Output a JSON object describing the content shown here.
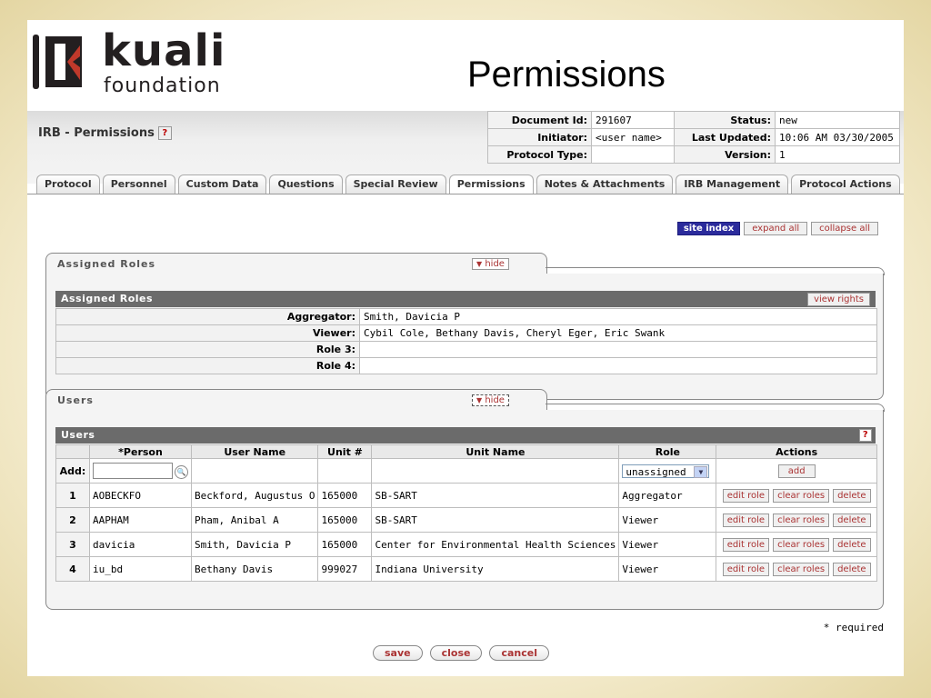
{
  "slide": {
    "title": "Permissions"
  },
  "logo": {
    "word1": "kuali",
    "word2": "foundation"
  },
  "header": {
    "doc_title": "IRB - Permissions",
    "help": "?",
    "info": [
      {
        "label": "Document Id:",
        "value": "291607",
        "label2": "Status:",
        "value2": "new"
      },
      {
        "label": "Initiator:",
        "value": "<user name>",
        "label2": "Last Updated:",
        "value2": "10:06 AM 03/30/2005"
      },
      {
        "label": "Protocol Type:",
        "value": "",
        "label2": "Version:",
        "value2": "1"
      }
    ]
  },
  "tabs": [
    "Protocol",
    "Personnel",
    "Custom Data",
    "Questions",
    "Special Review",
    "Permissions",
    "Notes & Attachments",
    "IRB Management",
    "Protocol Actions"
  ],
  "top_buttons": {
    "site_index": "site index",
    "expand_all": "expand all",
    "collapse_all": "collapse all"
  },
  "assigned_roles": {
    "panel_title": "Assigned Roles",
    "hide": "hide",
    "section_title": "Assigned Roles",
    "view_rights": "view rights",
    "rows": [
      {
        "label": "Aggregator:",
        "value": "Smith, Davicia P"
      },
      {
        "label": "Viewer:",
        "value": "Cybil Cole, Bethany Davis, Cheryl Eger, Eric Swank"
      },
      {
        "label": "Role 3:",
        "value": ""
      },
      {
        "label": "Role 4:",
        "value": ""
      }
    ]
  },
  "users": {
    "panel_title": "Users",
    "hide": "hide",
    "section_title": "Users",
    "help": "?",
    "columns": [
      "*Person",
      "User Name",
      "Unit #",
      "Unit Name",
      "Role",
      "Actions"
    ],
    "add_label": "Add:",
    "add_role_selected": "unassigned",
    "add_button": "add",
    "rows": [
      {
        "num": "1",
        "person": "AOBECKFO",
        "user_name": "Beckford, Augustus O",
        "unit": "165000",
        "unit_name": "SB-SART",
        "role": "Aggregator"
      },
      {
        "num": "2",
        "person": "AAPHAM",
        "user_name": "Pham, Anibal A",
        "unit": "165000",
        "unit_name": "SB-SART",
        "role": "Viewer"
      },
      {
        "num": "3",
        "person": "davicia",
        "user_name": "Smith, Davicia P",
        "unit": "165000",
        "unit_name": "Center for Environmental Health Sciences",
        "role": "Viewer"
      },
      {
        "num": "4",
        "person": "iu_bd",
        "user_name": "Bethany Davis",
        "unit": "999027",
        "unit_name": "Indiana University",
        "role": "Viewer"
      }
    ],
    "row_actions": {
      "edit": "edit role",
      "clear": "clear roles",
      "delete": "delete"
    }
  },
  "footer": {
    "required": "* required",
    "save": "save",
    "close": "close",
    "cancel": "cancel"
  }
}
